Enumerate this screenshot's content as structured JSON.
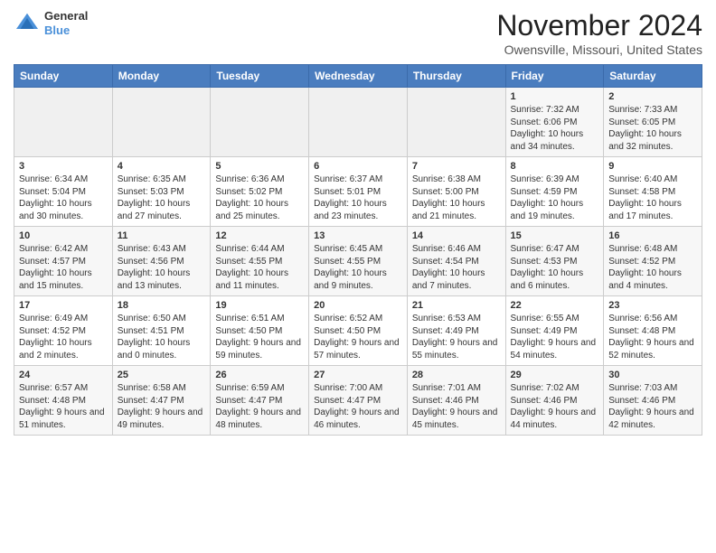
{
  "logo": {
    "general": "General",
    "blue": "Blue"
  },
  "header": {
    "month_year": "November 2024",
    "location": "Owensville, Missouri, United States"
  },
  "days_of_week": [
    "Sunday",
    "Monday",
    "Tuesday",
    "Wednesday",
    "Thursday",
    "Friday",
    "Saturday"
  ],
  "weeks": [
    [
      {
        "day": "",
        "info": ""
      },
      {
        "day": "",
        "info": ""
      },
      {
        "day": "",
        "info": ""
      },
      {
        "day": "",
        "info": ""
      },
      {
        "day": "",
        "info": ""
      },
      {
        "day": "1",
        "info": "Sunrise: 7:32 AM\nSunset: 6:06 PM\nDaylight: 10 hours and 34 minutes."
      },
      {
        "day": "2",
        "info": "Sunrise: 7:33 AM\nSunset: 6:05 PM\nDaylight: 10 hours and 32 minutes."
      }
    ],
    [
      {
        "day": "3",
        "info": "Sunrise: 6:34 AM\nSunset: 5:04 PM\nDaylight: 10 hours and 30 minutes."
      },
      {
        "day": "4",
        "info": "Sunrise: 6:35 AM\nSunset: 5:03 PM\nDaylight: 10 hours and 27 minutes."
      },
      {
        "day": "5",
        "info": "Sunrise: 6:36 AM\nSunset: 5:02 PM\nDaylight: 10 hours and 25 minutes."
      },
      {
        "day": "6",
        "info": "Sunrise: 6:37 AM\nSunset: 5:01 PM\nDaylight: 10 hours and 23 minutes."
      },
      {
        "day": "7",
        "info": "Sunrise: 6:38 AM\nSunset: 5:00 PM\nDaylight: 10 hours and 21 minutes."
      },
      {
        "day": "8",
        "info": "Sunrise: 6:39 AM\nSunset: 4:59 PM\nDaylight: 10 hours and 19 minutes."
      },
      {
        "day": "9",
        "info": "Sunrise: 6:40 AM\nSunset: 4:58 PM\nDaylight: 10 hours and 17 minutes."
      }
    ],
    [
      {
        "day": "10",
        "info": "Sunrise: 6:42 AM\nSunset: 4:57 PM\nDaylight: 10 hours and 15 minutes."
      },
      {
        "day": "11",
        "info": "Sunrise: 6:43 AM\nSunset: 4:56 PM\nDaylight: 10 hours and 13 minutes."
      },
      {
        "day": "12",
        "info": "Sunrise: 6:44 AM\nSunset: 4:55 PM\nDaylight: 10 hours and 11 minutes."
      },
      {
        "day": "13",
        "info": "Sunrise: 6:45 AM\nSunset: 4:55 PM\nDaylight: 10 hours and 9 minutes."
      },
      {
        "day": "14",
        "info": "Sunrise: 6:46 AM\nSunset: 4:54 PM\nDaylight: 10 hours and 7 minutes."
      },
      {
        "day": "15",
        "info": "Sunrise: 6:47 AM\nSunset: 4:53 PM\nDaylight: 10 hours and 6 minutes."
      },
      {
        "day": "16",
        "info": "Sunrise: 6:48 AM\nSunset: 4:52 PM\nDaylight: 10 hours and 4 minutes."
      }
    ],
    [
      {
        "day": "17",
        "info": "Sunrise: 6:49 AM\nSunset: 4:52 PM\nDaylight: 10 hours and 2 minutes."
      },
      {
        "day": "18",
        "info": "Sunrise: 6:50 AM\nSunset: 4:51 PM\nDaylight: 10 hours and 0 minutes."
      },
      {
        "day": "19",
        "info": "Sunrise: 6:51 AM\nSunset: 4:50 PM\nDaylight: 9 hours and 59 minutes."
      },
      {
        "day": "20",
        "info": "Sunrise: 6:52 AM\nSunset: 4:50 PM\nDaylight: 9 hours and 57 minutes."
      },
      {
        "day": "21",
        "info": "Sunrise: 6:53 AM\nSunset: 4:49 PM\nDaylight: 9 hours and 55 minutes."
      },
      {
        "day": "22",
        "info": "Sunrise: 6:55 AM\nSunset: 4:49 PM\nDaylight: 9 hours and 54 minutes."
      },
      {
        "day": "23",
        "info": "Sunrise: 6:56 AM\nSunset: 4:48 PM\nDaylight: 9 hours and 52 minutes."
      }
    ],
    [
      {
        "day": "24",
        "info": "Sunrise: 6:57 AM\nSunset: 4:48 PM\nDaylight: 9 hours and 51 minutes."
      },
      {
        "day": "25",
        "info": "Sunrise: 6:58 AM\nSunset: 4:47 PM\nDaylight: 9 hours and 49 minutes."
      },
      {
        "day": "26",
        "info": "Sunrise: 6:59 AM\nSunset: 4:47 PM\nDaylight: 9 hours and 48 minutes."
      },
      {
        "day": "27",
        "info": "Sunrise: 7:00 AM\nSunset: 4:47 PM\nDaylight: 9 hours and 46 minutes."
      },
      {
        "day": "28",
        "info": "Sunrise: 7:01 AM\nSunset: 4:46 PM\nDaylight: 9 hours and 45 minutes."
      },
      {
        "day": "29",
        "info": "Sunrise: 7:02 AM\nSunset: 4:46 PM\nDaylight: 9 hours and 44 minutes."
      },
      {
        "day": "30",
        "info": "Sunrise: 7:03 AM\nSunset: 4:46 PM\nDaylight: 9 hours and 42 minutes."
      }
    ]
  ]
}
